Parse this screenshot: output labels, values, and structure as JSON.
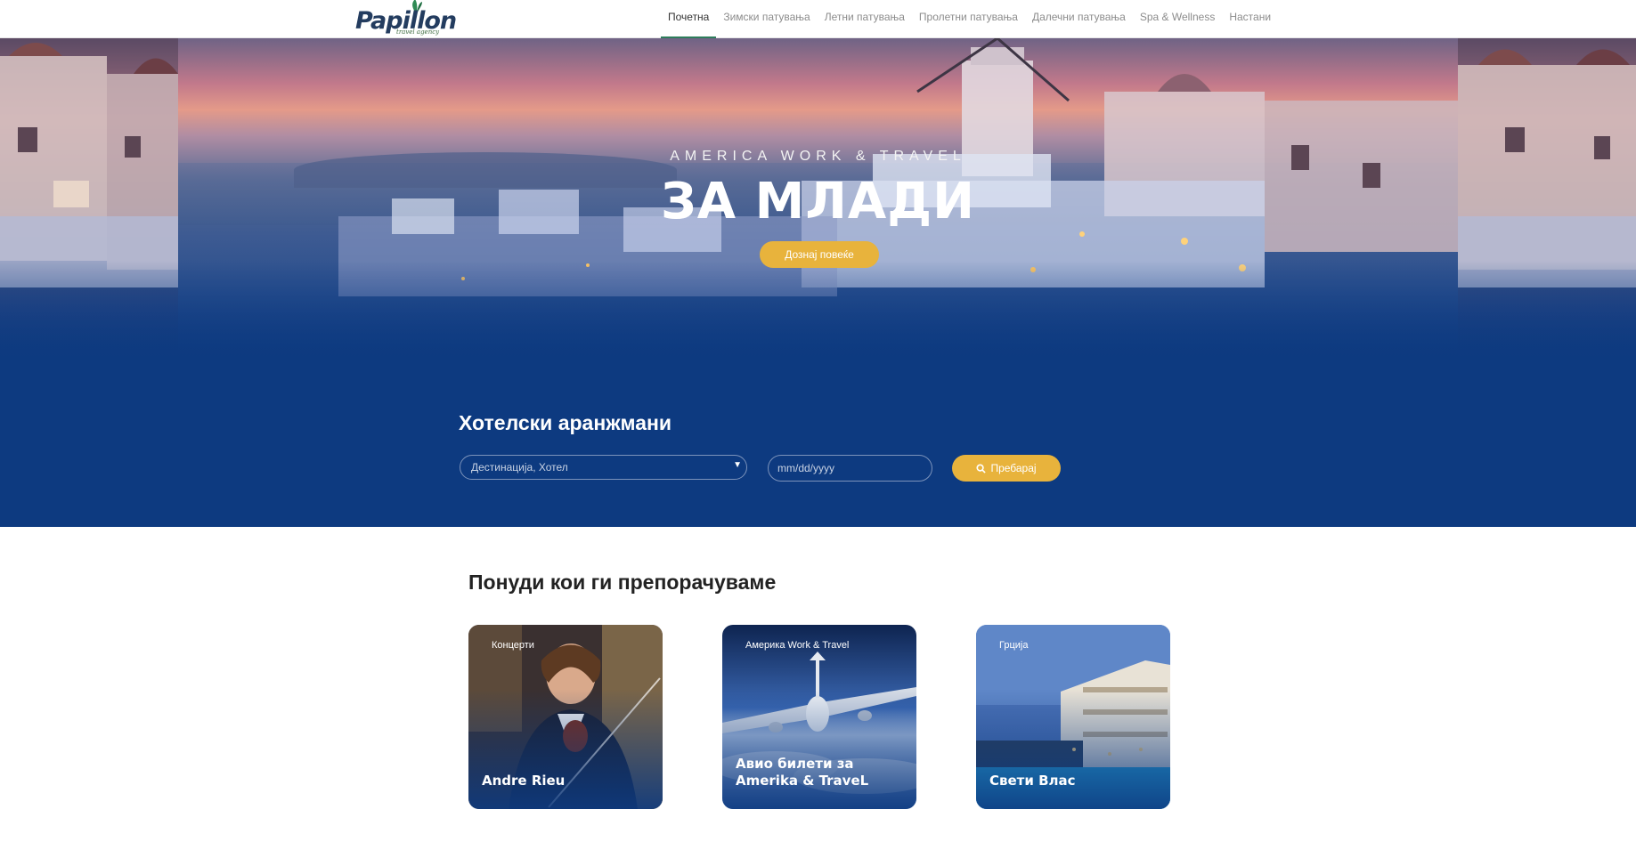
{
  "logo": {
    "name": "Papillon",
    "tagline": "travel agency"
  },
  "nav": {
    "items": [
      {
        "label": "Почетна",
        "active": true
      },
      {
        "label": "Зимски патувања",
        "active": false
      },
      {
        "label": "Летни патувања",
        "active": false
      },
      {
        "label": "Пролетни патувања",
        "active": false
      },
      {
        "label": "Далечни патувања",
        "active": false
      },
      {
        "label": "Spa & Wellness",
        "active": false
      },
      {
        "label": "Настани",
        "active": false
      }
    ]
  },
  "hero": {
    "kicker": "AMERICA WORK & TRAVEL",
    "title": "ЗА МЛАДИ",
    "button": "Дознај повеќе"
  },
  "search": {
    "title": "Хотелски аранжмани",
    "destination_placeholder": "Дестинација, Хотел",
    "date_placeholder": "mm/dd/yyyy",
    "button": "Пребарај",
    "icon": "search-icon"
  },
  "offers": {
    "title": "Понуди кои ги препорачуваме",
    "cards": [
      {
        "tag": "Концерти",
        "title": "Andre Rieu"
      },
      {
        "tag": "Америка Work & Travel",
        "title": "Авио билети за Amerika & TraveL"
      },
      {
        "tag": "Грција",
        "title": "Свети Влас"
      }
    ]
  },
  "colors": {
    "accent": "#e8b33c",
    "band": "#0d3a80",
    "nav_active_underline": "#2e7d5b"
  }
}
